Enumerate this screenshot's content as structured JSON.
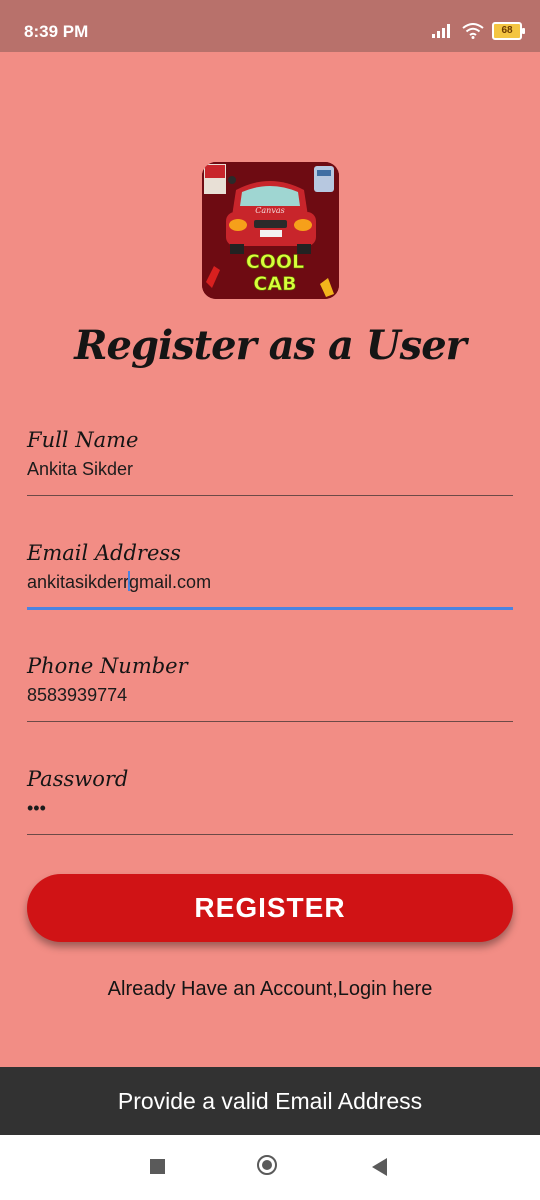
{
  "status_bar": {
    "time": "8:39 PM",
    "battery": "68",
    "icons": [
      "signal-icon",
      "wifi-icon",
      "battery-icon"
    ]
  },
  "logo": {
    "line1": "COOL",
    "line2": "CAB",
    "plate_text": "Canvas",
    "colors": {
      "background": "#6e0b12",
      "car": "#c8252b",
      "neon_text": "#d8ff3a"
    }
  },
  "title": "Register as a User",
  "form": {
    "full_name": {
      "label": "Full Name",
      "value": "Ankita Sikder"
    },
    "email": {
      "label": "Email Address",
      "value_before_caret": "ankitasikderr",
      "value_after_caret": "gmail.com"
    },
    "phone": {
      "label": "Phone Number",
      "value": "8583939774"
    },
    "password": {
      "label": "Password",
      "value": "•••"
    }
  },
  "register_button": "REGISTER",
  "login_link": "Already Have an Account,Login here",
  "snackbar": "Provide a valid Email Address",
  "colors": {
    "background": "#f28d85",
    "status_bar": "#b8716b",
    "button": "#d01315",
    "focus_line": "#4b83e0",
    "snackbar": "#323232"
  },
  "nav": {
    "icons": [
      "recents-icon",
      "home-icon",
      "back-icon"
    ]
  }
}
